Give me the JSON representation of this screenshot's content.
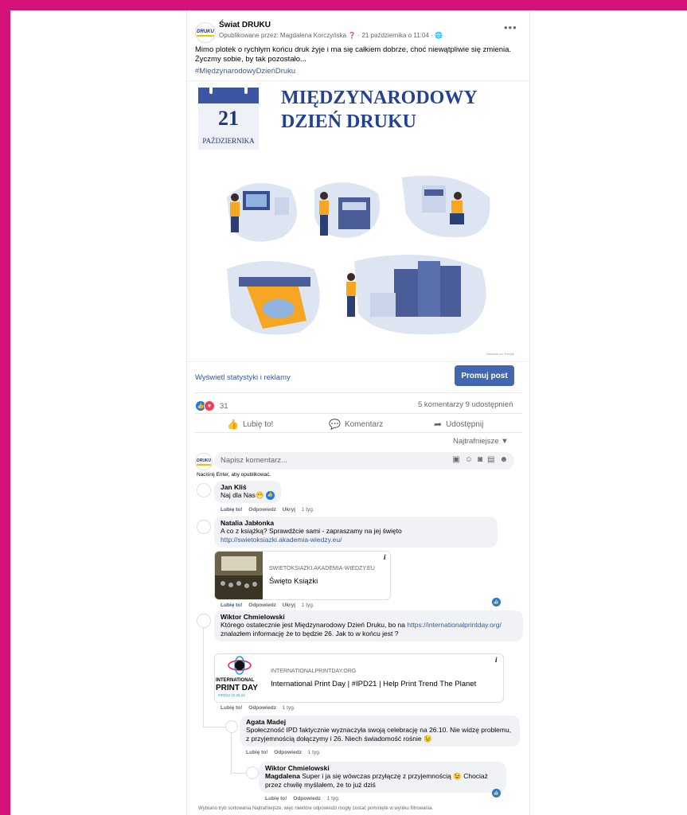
{
  "post": {
    "page_name": "Świat DRUKU",
    "avatar_logo": "DRUKU",
    "meta": "Opublikowane przez: Magdalena Korczyńska",
    "meta_time": "21 października o 11:04",
    "body": "Mimo plotek o rychłym końcu druk żyje i ma się całkiem dobrze, choć niewątpliwie się zmienia. Życzmy sobie, by tak pozostało...",
    "hashtag": "#MiędzynarodowyDzieńDruku",
    "more_icon": "ellipsis-icon"
  },
  "hero": {
    "calendar_day": "21",
    "calendar_month": "PAŹDZIERNIKA",
    "title_line1": "MIĘDZYNARODOWY",
    "title_line2": "DZIEŃ DRUKU",
    "credit": "Obrazek od: freepik",
    "colors": {
      "navy": "#24428f",
      "calendar": "#3b57a4",
      "orange": "#f5a623",
      "blob": "#dde4f2"
    }
  },
  "toolbar": {
    "stats_link": "Wyświetl statystyki i reklamy",
    "promote_button": "Promuj post"
  },
  "engagement": {
    "reaction_count": "31",
    "comments_shares": "5 komentarzy  9 udostępnień",
    "like_label": "Lubię to!",
    "comment_label": "Komentarz",
    "share_label": "Udostępnij",
    "sort_label": "Najtrafniejsze"
  },
  "composer": {
    "placeholder": "Napisz komentarz...",
    "hint": "Naciśnij Enter, aby opublikować."
  },
  "comments": [
    {
      "author": "Jan Kliś",
      "text": "Naj dla Nas",
      "emoji": "😁",
      "like": "Lubię to!",
      "reply": "Odpowiedz",
      "hide": "Ukryj",
      "time": "1 tyg."
    },
    {
      "author": "Natalia Jabłonka",
      "text": "A co z książką? Sprawdźcie sami - zapraszamy na jej święto",
      "link": "http://swietoksiazki.akademia-wiedzy.eu/",
      "preview_domain": "SWIETOKSIAZKI.AKADEMIA-WIEDZY.EU",
      "preview_title": "Święto Książki",
      "like": "Lubię to!",
      "reply": "Odpowiedz",
      "hide": "Ukryj",
      "time": "1 tyg."
    },
    {
      "author": "Wiktor Chmielowski",
      "text_before": "Którego ostatecznie jest Międzynarodowy Dzień Druku, bo na",
      "link": "https://internationalprintday.org/",
      "text_after": "znalazłem informację że to będzie 26. Jak to w końcu jest ?",
      "preview_domain": "INTERNATIONALPRINTDAY.ORG",
      "preview_title": "International Print Day | #IPD21 | Help Print Trend The Planet",
      "preview_logo_top": "INTERNATIONAL",
      "preview_logo_main": "PRINT DAY",
      "preview_logo_sub": "#IPD22  10.26.22",
      "like": "Lubię to!",
      "reply": "Odpowiedz",
      "time": "1 tyg."
    },
    {
      "author": "Agata Madej",
      "text": "Społeczność IPD faktycznie wyznaczyła swoją celebrację na 26.10. Nie widzę problemu, z przyjemnością dołączymy i 26. Niech świadomość rośnie",
      "emoji": "😉",
      "like": "Lubię to!",
      "reply": "Odpowiedz",
      "time": "1 tyg."
    },
    {
      "author": "Wiktor Chmielowski",
      "mention": "Magdalena",
      "text": "Super i ja się wówczas przyłączę z przyjemnością",
      "emoji": "😉",
      "text_after": "Chociaż przez chwilę myślałem, że to już dziś",
      "like": "Lubię to!",
      "reply": "Odpowiedz",
      "time": "1 tyg."
    }
  ],
  "footer_note": "Wybrano tryb sortowania Najtrafniejsze, więc niektóre odpowiedzi mogły zostać pominięte w wyniku filtrowania."
}
